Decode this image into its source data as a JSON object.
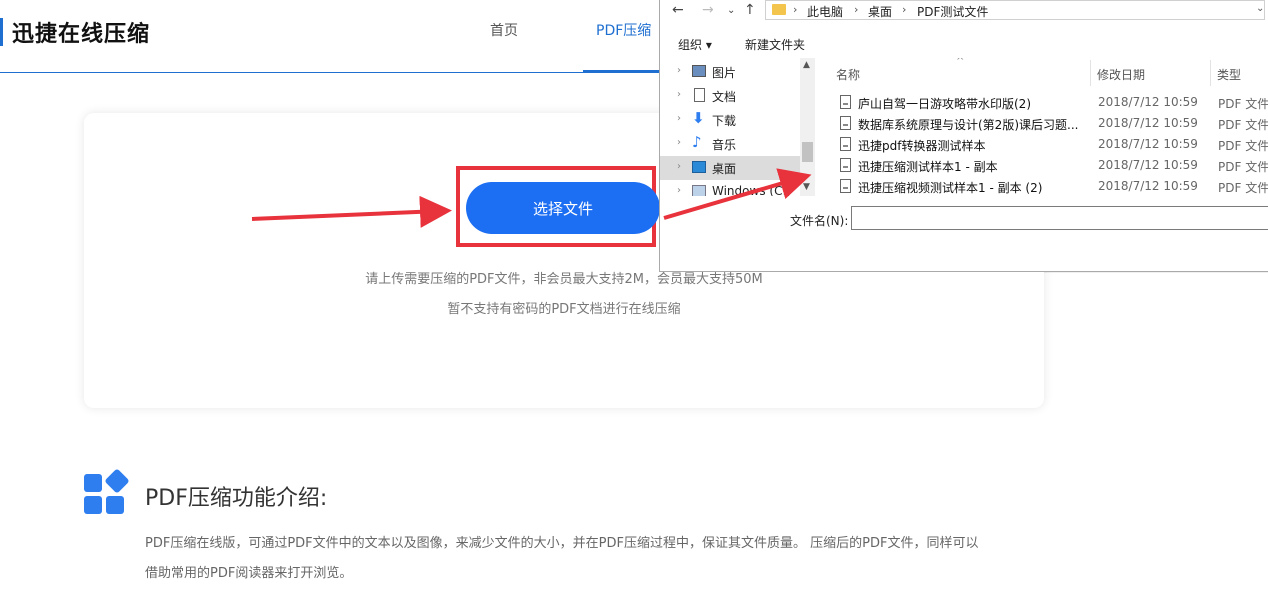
{
  "site": {
    "logo": "迅捷在线压缩",
    "nav": [
      "首页",
      "PDF压缩"
    ]
  },
  "upload": {
    "button_label": "选择文件",
    "hint1": "请上传需要压缩的PDF文件，非会员最大支持2M，会员最大支持50M",
    "hint2": "暂不支持有密码的PDF文档进行在线压缩"
  },
  "feature": {
    "title": "PDF压缩功能介绍:",
    "desc_line1": "PDF压缩在线版，可通过PDF文件中的文本以及图像，来减少文件的大小，并在PDF压缩过程中，保证其文件质量。 压缩后的PDF文件，同样可以",
    "desc_line2": "借助常用的PDF阅读器来打开浏览。"
  },
  "dialog": {
    "breadcrumb": [
      "此电脑",
      "桌面",
      "PDF测试文件"
    ],
    "toolbar": {
      "organize": "组织 ▾",
      "new_folder": "新建文件夹"
    },
    "nav_items": [
      {
        "label": "图片",
        "icon": "pictures-icon"
      },
      {
        "label": "文档",
        "icon": "document-icon"
      },
      {
        "label": "下载",
        "icon": "download-icon"
      },
      {
        "label": "音乐",
        "icon": "music-icon"
      },
      {
        "label": "桌面",
        "icon": "desktop-icon",
        "selected": true
      },
      {
        "label": "Windows (C:)",
        "icon": "drive-icon"
      }
    ],
    "columns": {
      "name": "名称",
      "date": "修改日期",
      "type": "类型"
    },
    "files": [
      {
        "name": "庐山自驾一日游攻略带水印版(2)",
        "date": "2018/7/12 10:59",
        "type": "PDF 文件"
      },
      {
        "name": "数据库系统原理与设计(第2版)课后习题...",
        "date": "2018/7/12 10:59",
        "type": "PDF 文件"
      },
      {
        "name": "迅捷pdf转换器测试样本",
        "date": "2018/7/12 10:59",
        "type": "PDF 文件"
      },
      {
        "name": "迅捷压缩测试样本1 - 副本",
        "date": "2018/7/12 10:59",
        "type": "PDF 文件"
      },
      {
        "name": "迅捷压缩视频测试样本1 - 副本 (2)",
        "date": "2018/7/12 10:59",
        "type": "PDF 文件"
      }
    ],
    "filename_label": "文件名(N):",
    "filename_value": ""
  },
  "colors": {
    "accent": "#1c6ef2",
    "annotation": "#e8323c"
  }
}
